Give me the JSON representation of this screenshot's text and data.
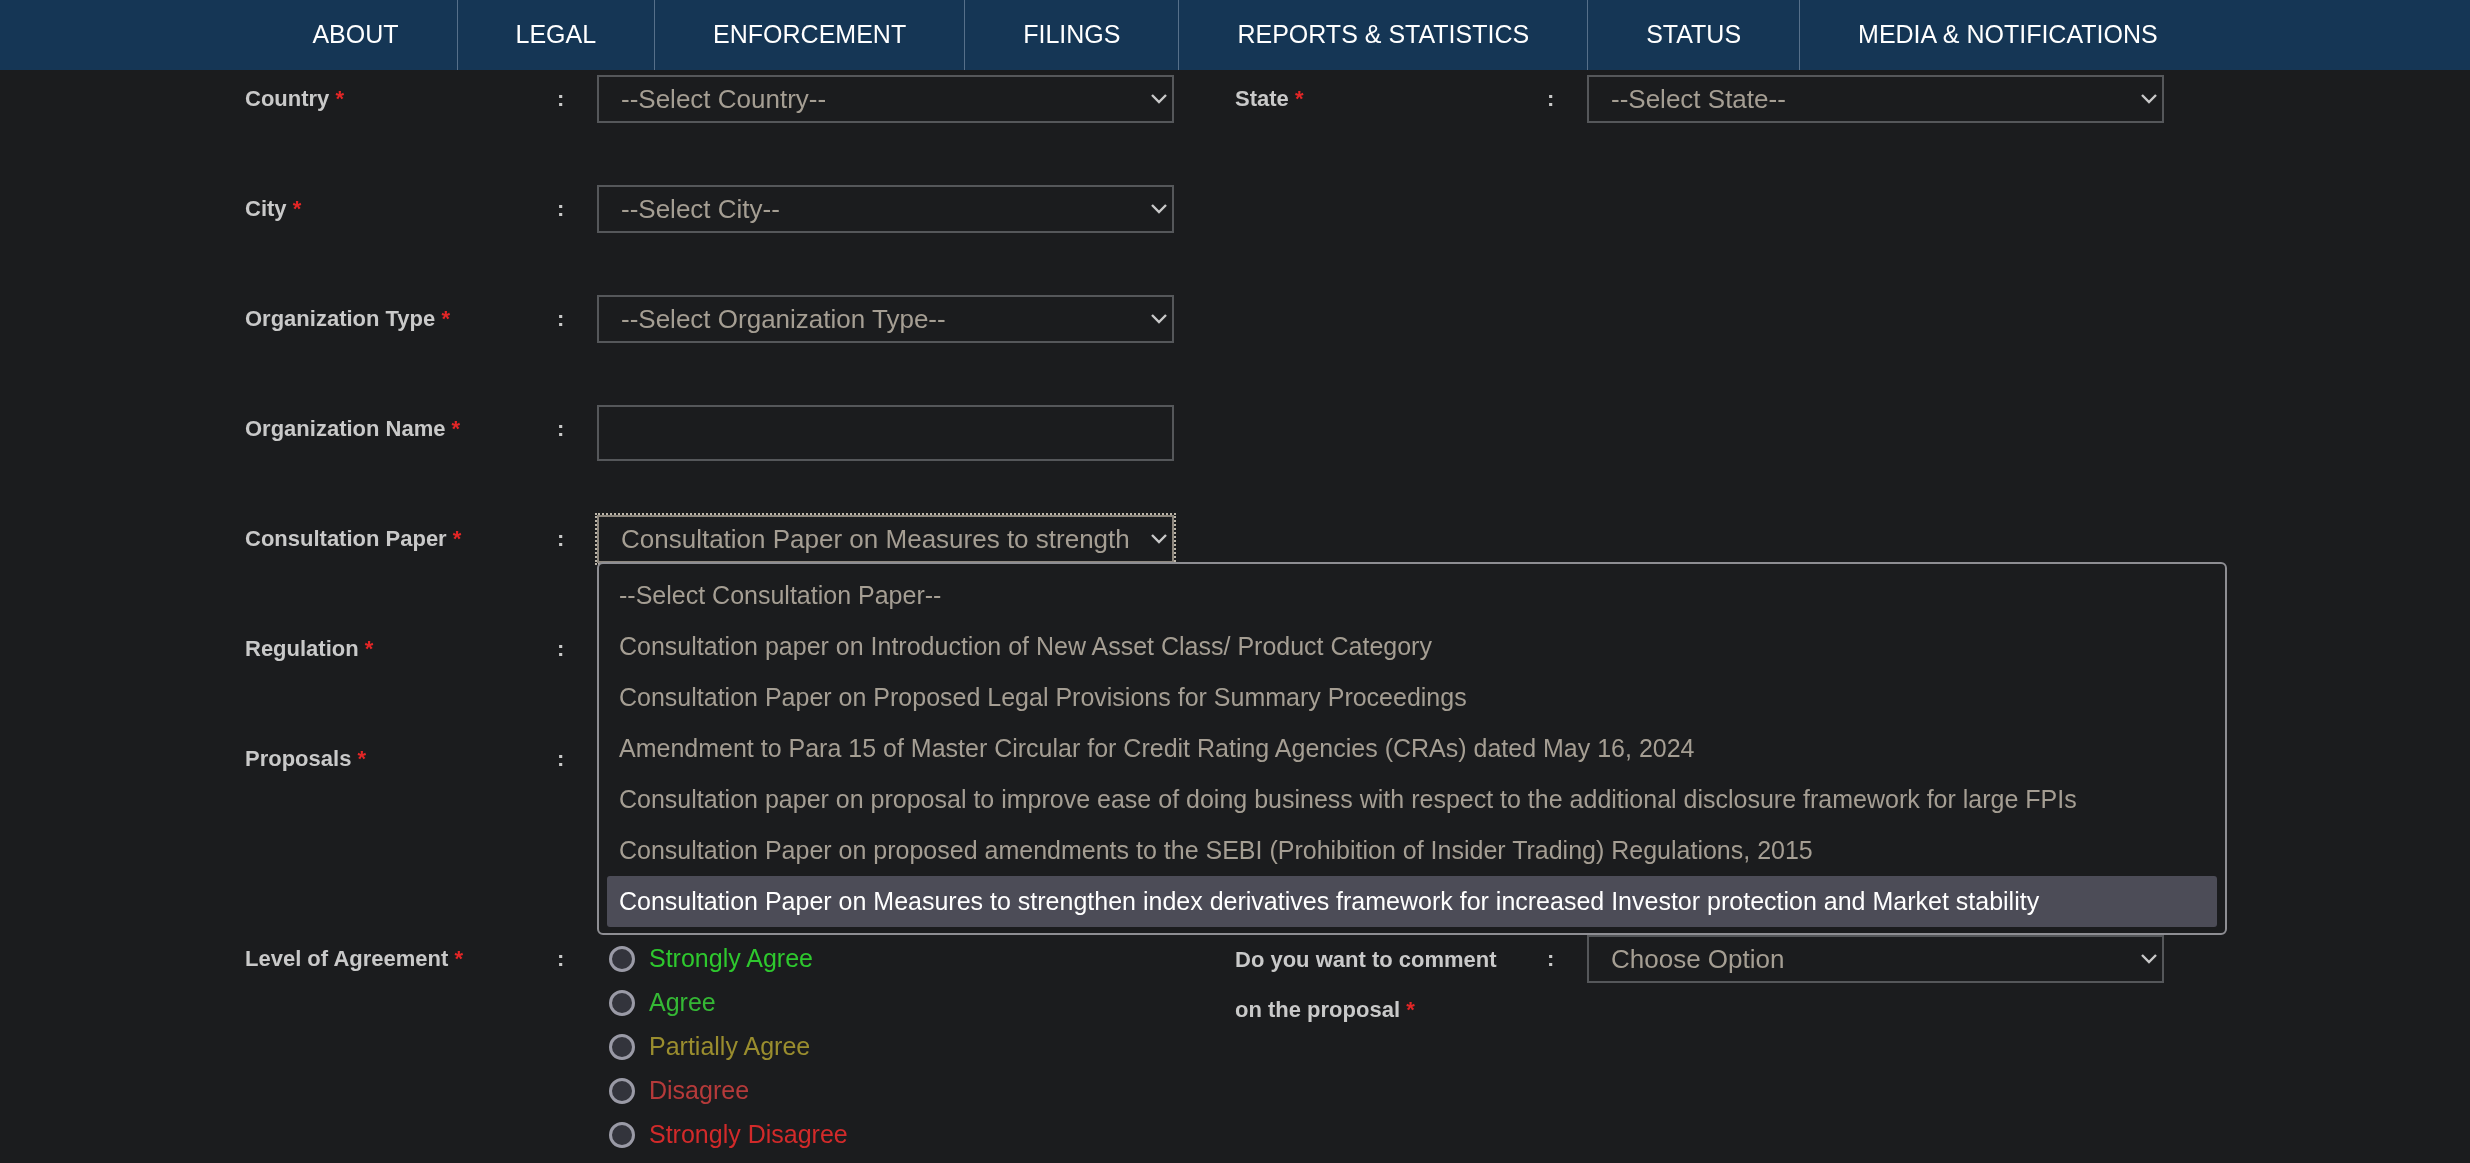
{
  "nav": [
    {
      "label": "ABOUT"
    },
    {
      "label": "LEGAL"
    },
    {
      "label": "ENFORCEMENT"
    },
    {
      "label": "FILINGS"
    },
    {
      "label": "REPORTS & STATISTICS"
    },
    {
      "label": "STATUS"
    },
    {
      "label": "MEDIA & NOTIFICATIONS"
    }
  ],
  "rows": [
    {
      "left": {
        "label": "Country",
        "required_mark": "*",
        "colon": ":",
        "kind": "select",
        "value": "--Select Country--"
      },
      "right": {
        "label": "State",
        "required_mark": "*",
        "colon": ":",
        "kind": "select",
        "value": "--Select State--"
      }
    },
    {
      "left": {
        "label": "City",
        "required_mark": "*",
        "colon": ":",
        "kind": "select",
        "value": "--Select City--"
      }
    },
    {
      "left": {
        "label": "Organization Type",
        "required_mark": "*",
        "colon": ":",
        "kind": "select",
        "value": "--Select Organization Type--"
      }
    },
    {
      "left": {
        "label": "Organization Name",
        "required_mark": "*",
        "colon": ":",
        "kind": "text"
      }
    },
    {
      "left": {
        "label": "Consultation Paper",
        "required_mark": "*",
        "colon": ":",
        "kind": "select",
        "value": "Consultation Paper on Measures to strength",
        "focused": true
      }
    },
    {
      "left": {
        "label": "Regulation",
        "required_mark": "*",
        "colon": ":",
        "kind": "covered"
      }
    },
    {
      "left": {
        "label": "Proposals",
        "required_mark": "*",
        "colon": ":",
        "kind": "covered_tall"
      }
    },
    {
      "left": {
        "label": "Level of Agreement",
        "required_mark": "*",
        "colon": ":",
        "kind": "radio",
        "options": [
          {
            "label": "Strongly Agree",
            "color": "#2ec82e",
            "checked": false
          },
          {
            "label": "Agree",
            "color": "#35b835",
            "checked": false
          },
          {
            "label": "Partially Agree",
            "color": "#9a8d2e",
            "checked": false
          },
          {
            "label": "Disagree",
            "color": "#b53a3a",
            "checked": false
          },
          {
            "label": "Strongly Disagree",
            "color": "#d22a2a",
            "checked": false
          }
        ]
      },
      "right": {
        "label": "Do you want to comment",
        "label_line2": "on the proposal",
        "required_mark": "*",
        "colon": ":",
        "kind": "select",
        "value": "Choose Option"
      }
    }
  ],
  "dropdown": {
    "options": [
      {
        "label": "--Select Consultation Paper--",
        "selected": false
      },
      {
        "label": "Consultation paper on Introduction of New Asset Class/ Product Category",
        "selected": false
      },
      {
        "label": "Consultation Paper on Proposed Legal Provisions for Summary Proceedings",
        "selected": false
      },
      {
        "label": "Amendment to Para 15 of Master Circular for Credit Rating Agencies (CRAs) dated May 16, 2024",
        "selected": false
      },
      {
        "label": "Consultation paper on proposal to improve ease of doing business with respect to the additional disclosure framework for large FPIs",
        "selected": false
      },
      {
        "label": "Consultation Paper on proposed amendments to the SEBI (Prohibition of Insider Trading) Regulations, 2015",
        "selected": false
      },
      {
        "label": "Consultation Paper on Measures to strengthen index derivatives framework for increased Investor protection and Market stability",
        "selected": true
      }
    ]
  }
}
